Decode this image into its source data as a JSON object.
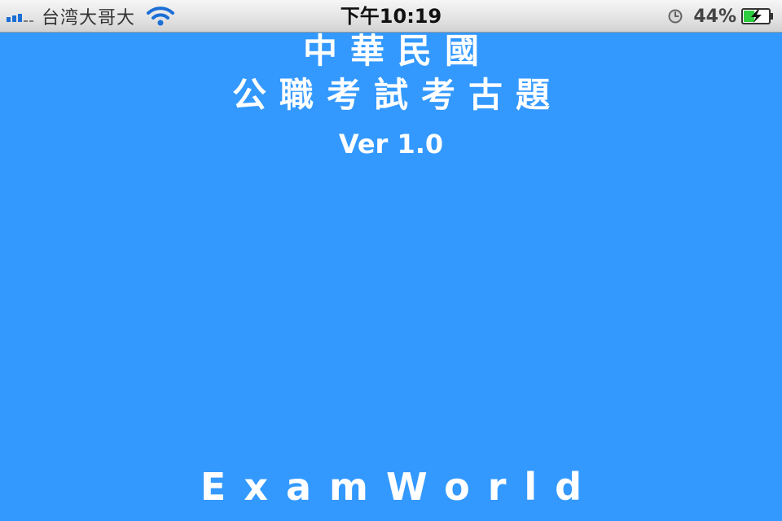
{
  "status_bar": {
    "carrier": "台湾大哥大",
    "time": "下午10:19",
    "battery_percent": "44%",
    "signal_bars": 3,
    "signal_max": 5,
    "wifi": true,
    "alarm": true,
    "battery_charging": true,
    "battery_level": 0.44
  },
  "splash": {
    "title_line_1": "中華民國",
    "title_line_2": "公職考試考古題",
    "version": "Ver 1.0",
    "brand": "ExamWorld"
  },
  "colors": {
    "background": "#3399ff",
    "text": "#ffffff",
    "signal": "#1b6fd6",
    "battery_fill": "#2ecc40"
  }
}
